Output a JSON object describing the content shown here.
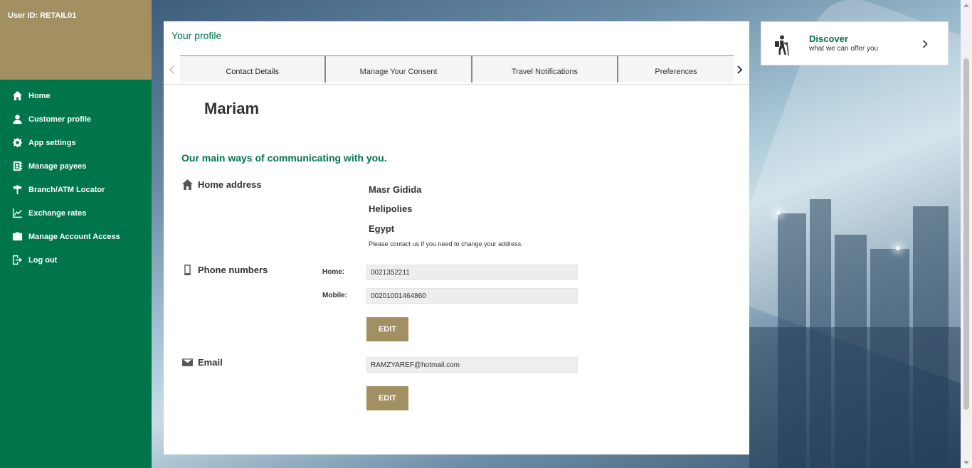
{
  "user": {
    "id_label": "User ID: RETAIL01"
  },
  "sidebar": {
    "items": [
      {
        "label": "Home",
        "icon": "home-icon"
      },
      {
        "label": "Customer profile",
        "icon": "user-icon"
      },
      {
        "label": "App settings",
        "icon": "gear-icon"
      },
      {
        "label": "Manage payees",
        "icon": "contacts-icon"
      },
      {
        "label": "Branch/ATM Locator",
        "icon": "signpost-icon"
      },
      {
        "label": "Exchange rates",
        "icon": "line-chart-icon"
      },
      {
        "label": "Manage Account Access",
        "icon": "briefcase-icon"
      },
      {
        "label": "Log out",
        "icon": "logout-icon"
      }
    ]
  },
  "profile": {
    "title": "Your profile",
    "tabs": [
      "Contact Details",
      "Manage Your Consent",
      "Travel Notifications",
      "Preferences"
    ],
    "active_tab": "Contact Details",
    "name": "Mariam",
    "section_heading": "Our main ways of communicating with you.",
    "home_address": {
      "label": "Home address",
      "lines": [
        "Masr Gidida",
        "Helipolies",
        "Egypt"
      ],
      "note": "Please contact us if you need to change your address."
    },
    "phone": {
      "label": "Phone numbers",
      "home_label": "Home:",
      "home_value": "0021352211",
      "mobile_label": "Mobile:",
      "mobile_value": "00201001464860",
      "edit_label": "EDIT"
    },
    "email": {
      "label": "Email",
      "value": "RAMZYAREF@hotmail.com",
      "edit_label": "EDIT"
    }
  },
  "discover": {
    "title": "Discover",
    "subtitle": "what we can offer you",
    "icon": "hiker-icon"
  },
  "colors": {
    "brand_green": "#00754a",
    "gold": "#a39062"
  }
}
